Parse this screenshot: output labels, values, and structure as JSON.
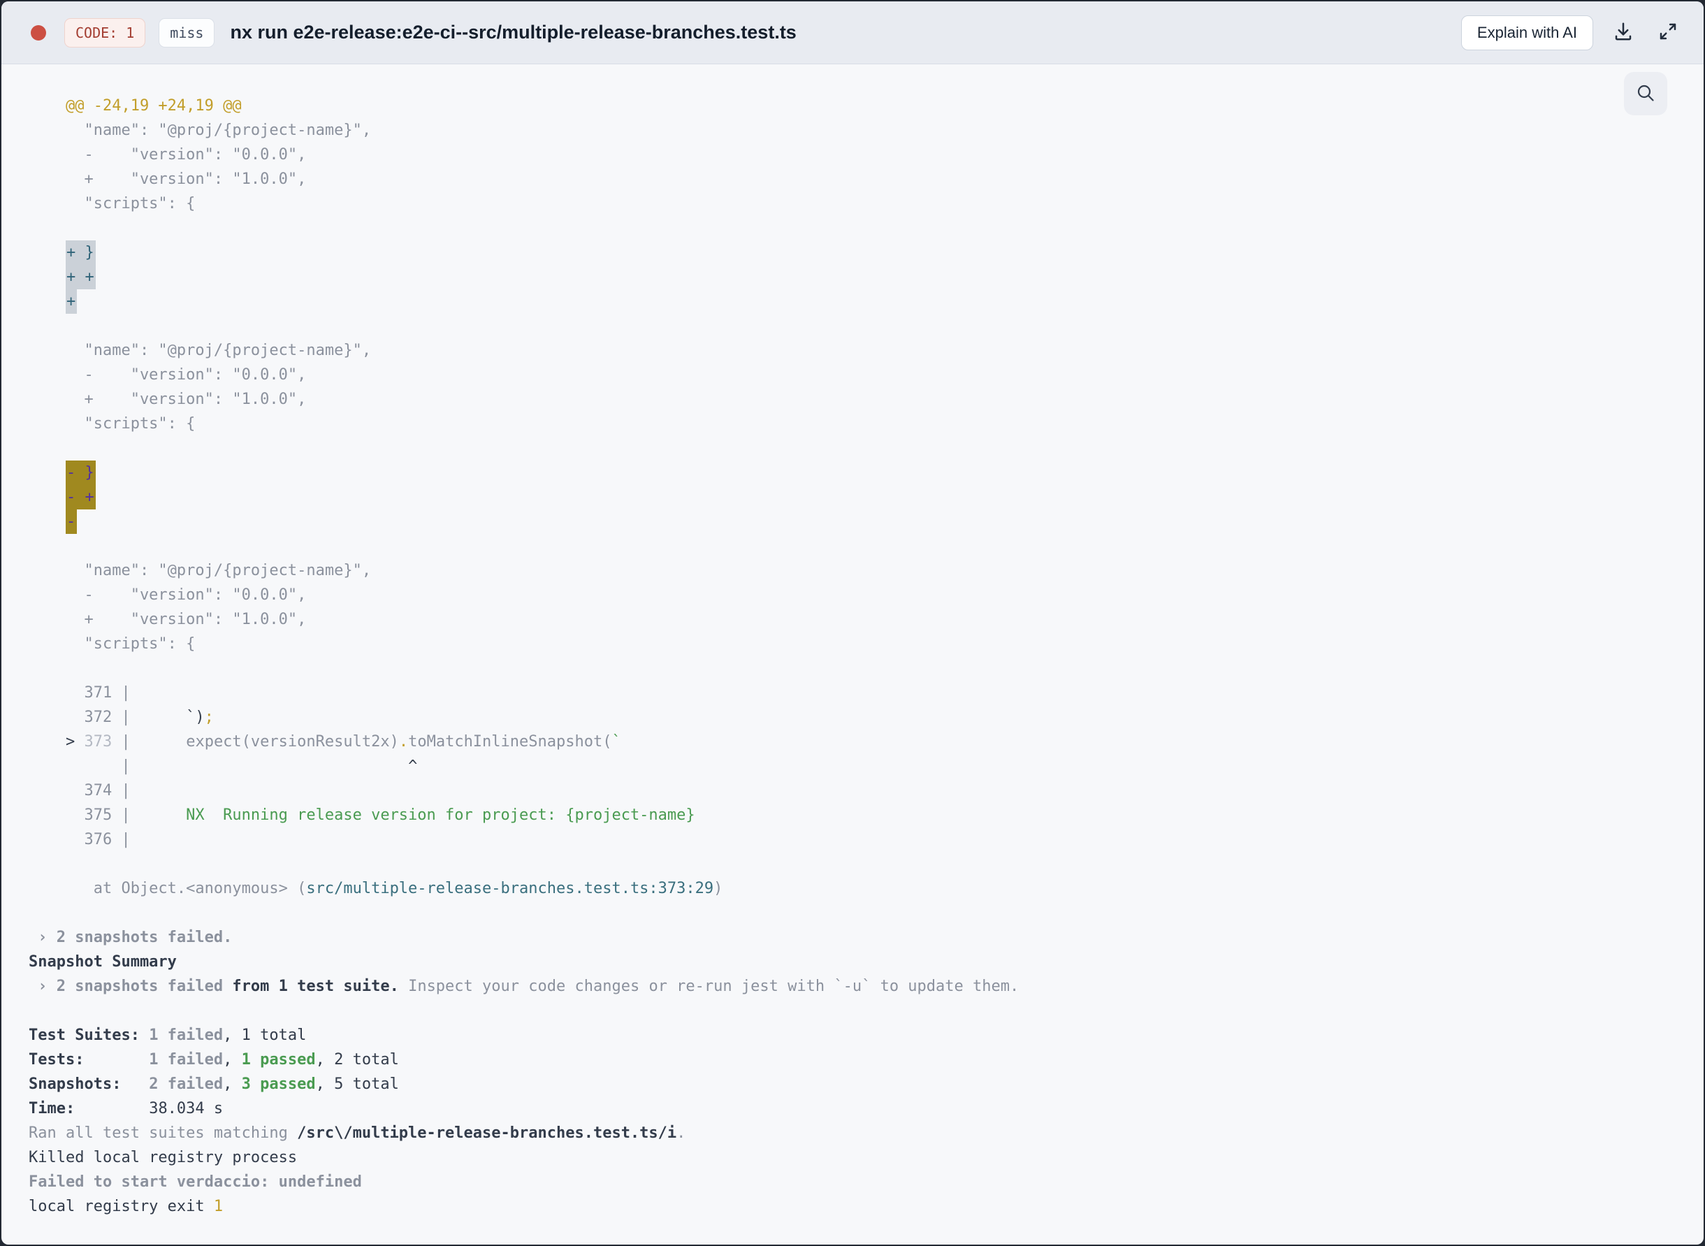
{
  "header": {
    "code_badge": "CODE: 1",
    "cache_badge": "miss",
    "title": "nx run e2e-release:e2e-ci--src/multiple-release-branches.test.ts",
    "explain_button": "Explain with AI"
  },
  "icons": {
    "status_dot": "red-status-dot",
    "download": "download-icon",
    "fullscreen": "fullscreen-icon",
    "search": "search-icon"
  },
  "colors": {
    "header_bg": "#e8ebf1",
    "terminal_bg": "#f7f8fa",
    "status_red": "#cc4f43",
    "code_badge_text": "#a33d31",
    "gray_text": "#8b919d",
    "dark_text": "#333c4b",
    "gold_text": "#c29e2a",
    "green_text": "#4a9b51",
    "teal_link": "#3a6f7e",
    "added_highlight_bg": "#cbd1d8",
    "added_highlight_text": "#2f6378",
    "removed_highlight_bg": "#a0891f",
    "removed_highlight_text": "#522fa0"
  },
  "terminal": {
    "lines": [
      [
        {
          "t": "    @@ -24,19 +24,19 @@",
          "c": "gold"
        }
      ],
      [
        {
          "t": "      \"name\": \"@proj/{project-name}\",",
          "c": "gray"
        }
      ],
      [
        {
          "t": "      -    \"version\": \"0.0.0\",",
          "c": "gray"
        }
      ],
      [
        {
          "t": "      +    \"version\": \"1.0.0\",",
          "c": "gray"
        }
      ],
      [
        {
          "t": "      \"scripts\": {",
          "c": "gray"
        }
      ],
      [],
      [
        {
          "t": "    ",
          "c": "gray"
        },
        {
          "t": "+ }",
          "c": "hl-add"
        }
      ],
      [
        {
          "t": "    ",
          "c": "gray"
        },
        {
          "t": "+ +",
          "c": "hl-add"
        }
      ],
      [
        {
          "t": "    ",
          "c": "gray"
        },
        {
          "t": "+",
          "c": "hl-add"
        }
      ],
      [],
      [
        {
          "t": "      \"name\": \"@proj/{project-name}\",",
          "c": "gray"
        }
      ],
      [
        {
          "t": "      -    \"version\": \"0.0.0\",",
          "c": "gray"
        }
      ],
      [
        {
          "t": "      +    \"version\": \"1.0.0\",",
          "c": "gray"
        }
      ],
      [
        {
          "t": "      \"scripts\": {",
          "c": "gray"
        }
      ],
      [],
      [
        {
          "t": "    ",
          "c": "gray"
        },
        {
          "t": "- }",
          "c": "hl-del"
        }
      ],
      [
        {
          "t": "    ",
          "c": "gray"
        },
        {
          "t": "- +",
          "c": "hl-del"
        }
      ],
      [
        {
          "t": "    ",
          "c": "gray"
        },
        {
          "t": "-",
          "c": "hl-del"
        }
      ],
      [],
      [
        {
          "t": "      \"name\": \"@proj/{project-name}\",",
          "c": "gray"
        }
      ],
      [
        {
          "t": "      -    \"version\": \"0.0.0\",",
          "c": "gray"
        }
      ],
      [
        {
          "t": "      +    \"version\": \"1.0.0\",",
          "c": "gray"
        }
      ],
      [
        {
          "t": "      \"scripts\": {",
          "c": "gray"
        }
      ],
      [],
      [
        {
          "t": "      371 |",
          "c": "gray"
        }
      ],
      [
        {
          "t": "      372 |      ",
          "c": "gray"
        },
        {
          "t": "`)",
          "c": "dark"
        },
        {
          "t": ";",
          "c": "gold"
        }
      ],
      [
        {
          "t": "    ",
          "c": "gray"
        },
        {
          "t": "> ",
          "c": "dark"
        },
        {
          "t": "373",
          "c": "lgray"
        },
        {
          "t": " |      ",
          "c": "gray"
        },
        {
          "t": "expect(versionResult2x)",
          "c": "gray"
        },
        {
          "t": ".",
          "c": "gold"
        },
        {
          "t": "toMatchInlineSnapshot(",
          "c": "gray"
        },
        {
          "t": "`",
          "c": "green"
        }
      ],
      [
        {
          "t": "          |",
          "c": "gray"
        },
        {
          "t": "                              ",
          "c": "gray"
        },
        {
          "t": "^",
          "c": "dark"
        }
      ],
      [
        {
          "t": "      374 |",
          "c": "gray"
        }
      ],
      [
        {
          "t": "      375 |",
          "c": "gray"
        },
        {
          "t": "      NX  Running release version for project: {project-name}",
          "c": "green"
        }
      ],
      [
        {
          "t": "      376 |",
          "c": "gray"
        }
      ],
      [],
      [
        {
          "t": "       at Object.<anonymous> (",
          "c": "gray"
        },
        {
          "t": "src/multiple-release-branches.test.ts:373:29",
          "c": "teal"
        },
        {
          "t": ")",
          "c": "gray"
        }
      ],
      [],
      [
        {
          "t": " › 2 snapshots failed.",
          "c": "grayb"
        }
      ],
      [
        {
          "t": "Snapshot Summary",
          "c": "darkb"
        }
      ],
      [
        {
          "t": " › 2 snapshots failed",
          "c": "grayb"
        },
        {
          "t": " from 1 test suite.",
          "c": "darkb"
        },
        {
          "t": " Inspect your code changes or re-run jest with `-u` to update them.",
          "c": "gray"
        }
      ],
      [],
      [
        {
          "t": "Test Suites: ",
          "c": "darkb"
        },
        {
          "t": "1 failed",
          "c": "grayb"
        },
        {
          "t": ", 1 total",
          "c": "dark"
        }
      ],
      [
        {
          "t": "Tests:",
          "c": "darkb"
        },
        {
          "t": "       ",
          "c": "dark"
        },
        {
          "t": "1 failed",
          "c": "grayb"
        },
        {
          "t": ", ",
          "c": "dark"
        },
        {
          "t": "1 passed",
          "c": "greenb"
        },
        {
          "t": ", 2 total",
          "c": "dark"
        }
      ],
      [
        {
          "t": "Snapshots:",
          "c": "darkb"
        },
        {
          "t": "   ",
          "c": "dark"
        },
        {
          "t": "2 failed",
          "c": "grayb"
        },
        {
          "t": ", ",
          "c": "dark"
        },
        {
          "t": "3 passed",
          "c": "greenb"
        },
        {
          "t": ", 5 total",
          "c": "dark"
        }
      ],
      [
        {
          "t": "Time:",
          "c": "darkb"
        },
        {
          "t": "        38.034 s",
          "c": "dark"
        }
      ],
      [
        {
          "t": "Ran all test suites matching ",
          "c": "gray"
        },
        {
          "t": "/src\\/multiple-release-branches.test.ts/i",
          "c": "darkb"
        },
        {
          "t": ".",
          "c": "gray"
        }
      ],
      [
        {
          "t": "Killed local registry process",
          "c": "dark"
        }
      ],
      [
        {
          "t": "Failed to start verdaccio: undefined",
          "c": "grayb"
        }
      ],
      [
        {
          "t": "local registry exit ",
          "c": "dark"
        },
        {
          "t": "1",
          "c": "gold"
        }
      ]
    ]
  }
}
